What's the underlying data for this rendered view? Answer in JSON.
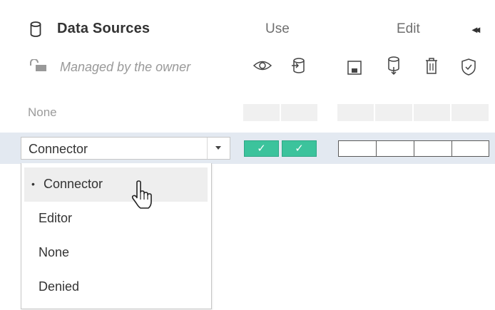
{
  "header": {
    "title": "Data Sources",
    "use_label": "Use",
    "edit_label": "Edit",
    "collapse_glyph": "◂◂",
    "managed_text": "Managed by the owner"
  },
  "rows": [
    {
      "label": "None"
    }
  ],
  "selected_row": {
    "value": "Connector",
    "use_marks": [
      "✓",
      "✓"
    ]
  },
  "menu": {
    "bullet": "•",
    "items": [
      {
        "label": "Connector",
        "selected": true
      },
      {
        "label": "Editor"
      },
      {
        "label": "None"
      },
      {
        "label": "Denied"
      }
    ]
  },
  "icons": {
    "use": [
      "eye-icon",
      "download-data-icon"
    ],
    "edit": [
      "save-icon",
      "download-source-icon",
      "trash-icon",
      "certify-icon"
    ]
  },
  "colors": {
    "allowed": "#3cc39c",
    "row_highlight": "#e3e9f1"
  }
}
